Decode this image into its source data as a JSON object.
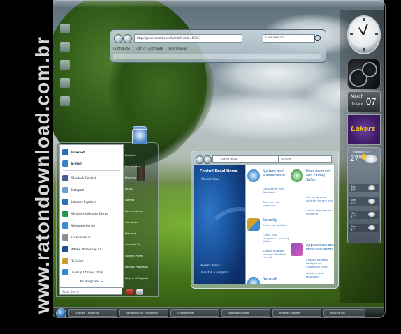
{
  "watermark": "www.ratondownload.com.br",
  "ie": {
    "address": "http://go.microsoft.com/fwlink/?LinkId=69157",
    "search_placeholder": "Live Search",
    "toolbar": [
      "Contribute",
      "Edit in Contribute",
      "Post to Blog"
    ]
  },
  "gadgets": {
    "calendar": {
      "month": "March",
      "day": "Friday",
      "date": "07"
    },
    "slideshow_text": "Lakers",
    "weather": {
      "city": "Hartford, CT",
      "temp": "27°",
      "forecast": [
        {
          "day": "Sat",
          "temp": "29°"
        },
        {
          "day": "Sun",
          "temp": "25°"
        },
        {
          "day": "Mon",
          "temp": "21°"
        },
        {
          "day": "Tue",
          "temp": "27°"
        }
      ]
    }
  },
  "start_menu": {
    "pinned": [
      {
        "label": "Internet",
        "color": "#2c6fb6"
      },
      {
        "label": "E-mail",
        "color": "#3a7fc8"
      }
    ],
    "recent": [
      {
        "label": "Stardock Central",
        "color": "#4a5a9c"
      },
      {
        "label": "Notepad",
        "color": "#6aa0d8"
      },
      {
        "label": "Internet Explorer",
        "color": "#2c6fb6"
      },
      {
        "label": "Windows Ultimate Extras",
        "color": "#1f9a4a"
      },
      {
        "label": "Welcome Center",
        "color": "#3d8bd0"
      },
      {
        "label": "Disk Cleanup",
        "color": "#8a8f93"
      },
      {
        "label": "Adobe Photoshop CS3",
        "color": "#1f4f8a"
      },
      {
        "label": "TuGuitar",
        "color": "#c8a030"
      },
      {
        "label": "TuneUp Utilities 2008",
        "color": "#2f8ac8"
      }
    ],
    "all_programs": "All Programs",
    "search_placeholder": "Start Search",
    "right_items": [
      "Ratinho",
      "Documents",
      "Pictures",
      "Music",
      "Games",
      "Recent Items",
      "Computer",
      "Network",
      "Connect To",
      "Control Panel",
      "Default Programs",
      "Help and Support"
    ]
  },
  "control_panel": {
    "breadcrumb": "Control Panel",
    "search_placeholder": "Search",
    "home": "Control Panel Home",
    "classic_view": "Classic View",
    "recent_tasks": "Recent Tasks",
    "recent_task_item": "Uninstall a program",
    "categories": [
      {
        "title": "System and Maintenance",
        "links": [
          "Get started with Windows",
          "Back up your computer"
        ],
        "icon_color": "#3d8bd0"
      },
      {
        "title": "User Accounts and Family Safety",
        "links": [
          "Set up parental controls for any user",
          "Add or remove user accounts"
        ],
        "icon_color": "#4aa04a"
      },
      {
        "title": "Security",
        "links": [
          "Check for updates",
          "Check this computer's security status",
          "Allow a program through Windows Firewall"
        ],
        "icon_color": "#d8a020"
      },
      {
        "title": "Appearance and Personalization",
        "links": [
          "Change desktop background",
          "Customize colors",
          "Adjust screen resolution"
        ],
        "icon_color": "#8a4fc0"
      },
      {
        "title": "Network",
        "links": [],
        "icon_color": "#3d8bd0"
      }
    ]
  },
  "taskbar": {
    "buttons": [
      "Untitled - Notepad",
      "Windows Live Messenger",
      "Control Panel",
      "Stardock Central",
      "Internet Explorer",
      "Recycle Bin"
    ]
  }
}
